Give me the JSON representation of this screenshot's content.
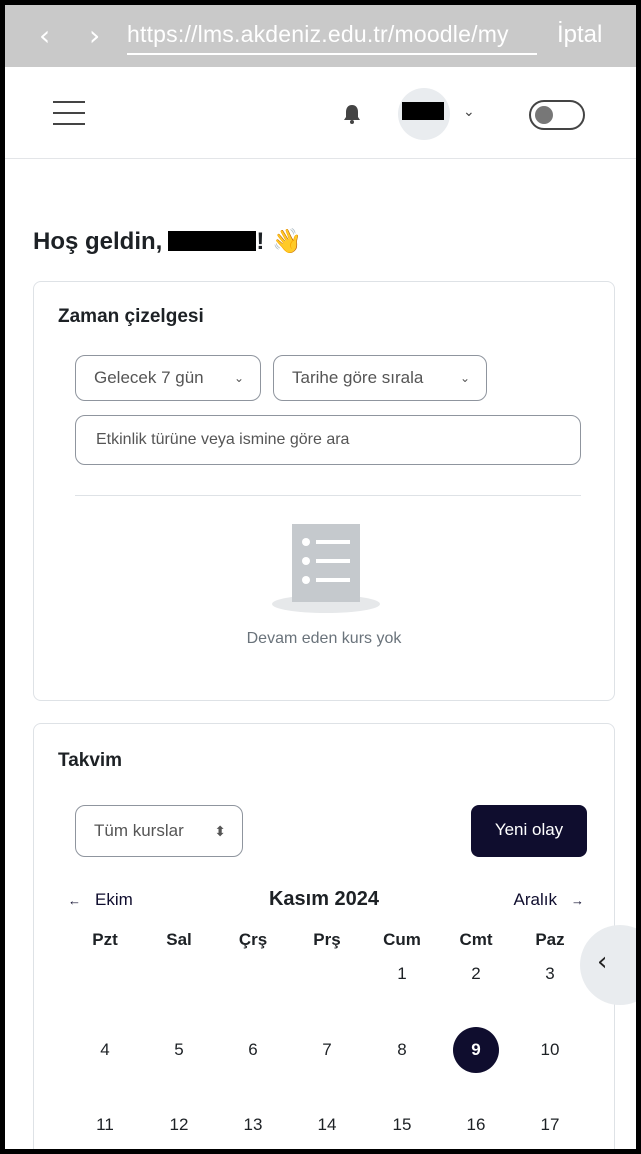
{
  "browser": {
    "back_icon": "‹",
    "forward_icon": "›",
    "url": "https://lms.akdeniz.edu.tr/moodle/my",
    "cancel_label": "İptal"
  },
  "header": {
    "menu_icon": "hamburger-icon",
    "bell_icon": "bell-icon",
    "avatar_caret": "⌄"
  },
  "greeting": {
    "prefix": "Hoş geldin,",
    "suffix": "!",
    "emoji": "👋"
  },
  "timeline": {
    "title": "Zaman çizelgesi",
    "filter_range": "Gelecek 7 gün",
    "filter_sort": "Tarihe göre sırala",
    "search_placeholder": "Etkinlik türüne veya ismine göre ara",
    "empty_message": "Devam eden kurs yok"
  },
  "calendar": {
    "title": "Takvim",
    "course_filter": "Tüm kurslar",
    "new_event_label": "Yeni olay",
    "prev_month": "Ekim",
    "next_month": "Aralık",
    "current_month": "Kasım 2024",
    "weekdays": [
      "Pzt",
      "Sal",
      "Çrş",
      "Prş",
      "Cum",
      "Cmt",
      "Paz"
    ],
    "weeks": [
      [
        "",
        "",
        "",
        "",
        "1",
        "2",
        "3"
      ],
      [
        "4",
        "5",
        "6",
        "7",
        "8",
        "9",
        "10"
      ],
      [
        "11",
        "12",
        "13",
        "14",
        "15",
        "16",
        "17"
      ]
    ],
    "today": "9"
  },
  "colors": {
    "primary": "#0f0d2e",
    "border": "#8f959e"
  }
}
